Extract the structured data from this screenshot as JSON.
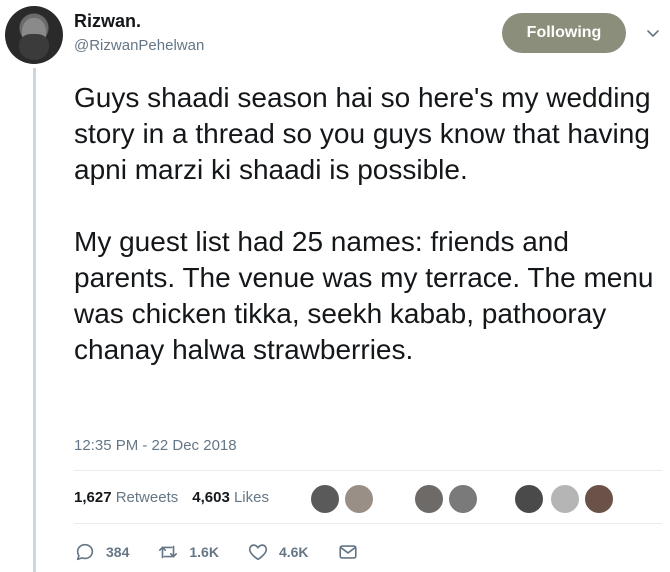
{
  "author": {
    "name": "Rizwan.",
    "handle": "@RizwanPehelwan",
    "avatar_icon": "profile-avatar"
  },
  "follow_button": {
    "label": "Following",
    "color": "#8a8e7a"
  },
  "tweet": {
    "paragraphs": [
      "Guys shaadi season hai so here's my wedding story in a thread so you guys know that having apni marzi ki shaadi is possible.",
      "My guest list had 25 names: friends and parents. The venue was my terrace. The menu was chicken tikka, seekh kabab, pathooray chanay halwa strawberries."
    ],
    "timestamp": "12:35 PM - 22 Dec 2018"
  },
  "stats": {
    "retweets": {
      "count": "1,627",
      "label": "Retweets"
    },
    "likes": {
      "count": "4,603",
      "label": "Likes"
    }
  },
  "actions": {
    "reply": {
      "icon": "reply-icon",
      "count": "384"
    },
    "retweet": {
      "icon": "retweet-icon",
      "count": "1.6K"
    },
    "like": {
      "icon": "heart-icon",
      "count": "4.6K"
    },
    "message": {
      "icon": "envelope-icon"
    }
  },
  "colors": {
    "text_primary": "#14171a",
    "text_secondary": "#657786",
    "border": "#e6ecf0",
    "thread_line": "#ccd6dd"
  }
}
